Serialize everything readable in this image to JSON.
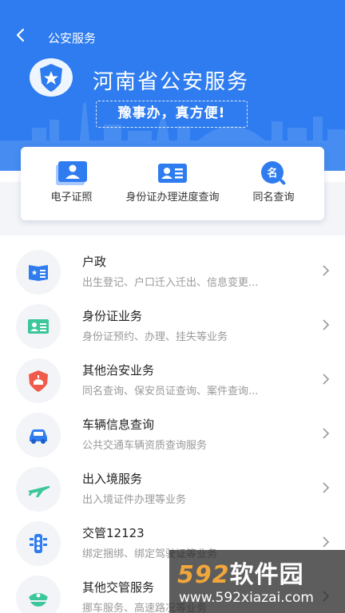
{
  "nav": {
    "title": "公安服务"
  },
  "hero": {
    "title": "河南省公安服务",
    "slogan": "豫事办，真方便!"
  },
  "quick_actions": [
    {
      "label": "电子证照",
      "icon": "id-card-photo-icon"
    },
    {
      "label": "身份证办理进度查询",
      "icon": "id-card-icon"
    },
    {
      "label": "同名查询",
      "icon": "name-search-icon"
    }
  ],
  "services": [
    {
      "title": "户政",
      "subtitle": "出生登记、户口迁入迁出、信息变更...",
      "icon": "household-book-icon"
    },
    {
      "title": "身份证业务",
      "subtitle": "身份证预约、办理、挂失等业务",
      "icon": "id-card-icon"
    },
    {
      "title": "其他治安业务",
      "subtitle": "同名查询、保安员证查询、案件查询...",
      "icon": "police-shield-icon"
    },
    {
      "title": "车辆信息查询",
      "subtitle": "公共交通车辆资质查询服务",
      "icon": "vehicle-icon"
    },
    {
      "title": "出入境服务",
      "subtitle": "出入境证件办理等业务",
      "icon": "airplane-icon"
    },
    {
      "title": "交管12123",
      "subtitle": "绑定捆绑、绑定驾驶证等业务",
      "icon": "traffic-light-icon"
    },
    {
      "title": "其他交管服务",
      "subtitle": "挪车服务、高速路况等业务",
      "icon": "police-cap-icon"
    }
  ],
  "watermark": {
    "brand_num": "592",
    "brand_cn": "软件园",
    "url": "www.592xiazai.com"
  },
  "colors": {
    "primary": "#2e7cf0",
    "background": "#f3f5f8",
    "accent_red": "#f05a4a",
    "accent_green": "#3cc79a"
  }
}
